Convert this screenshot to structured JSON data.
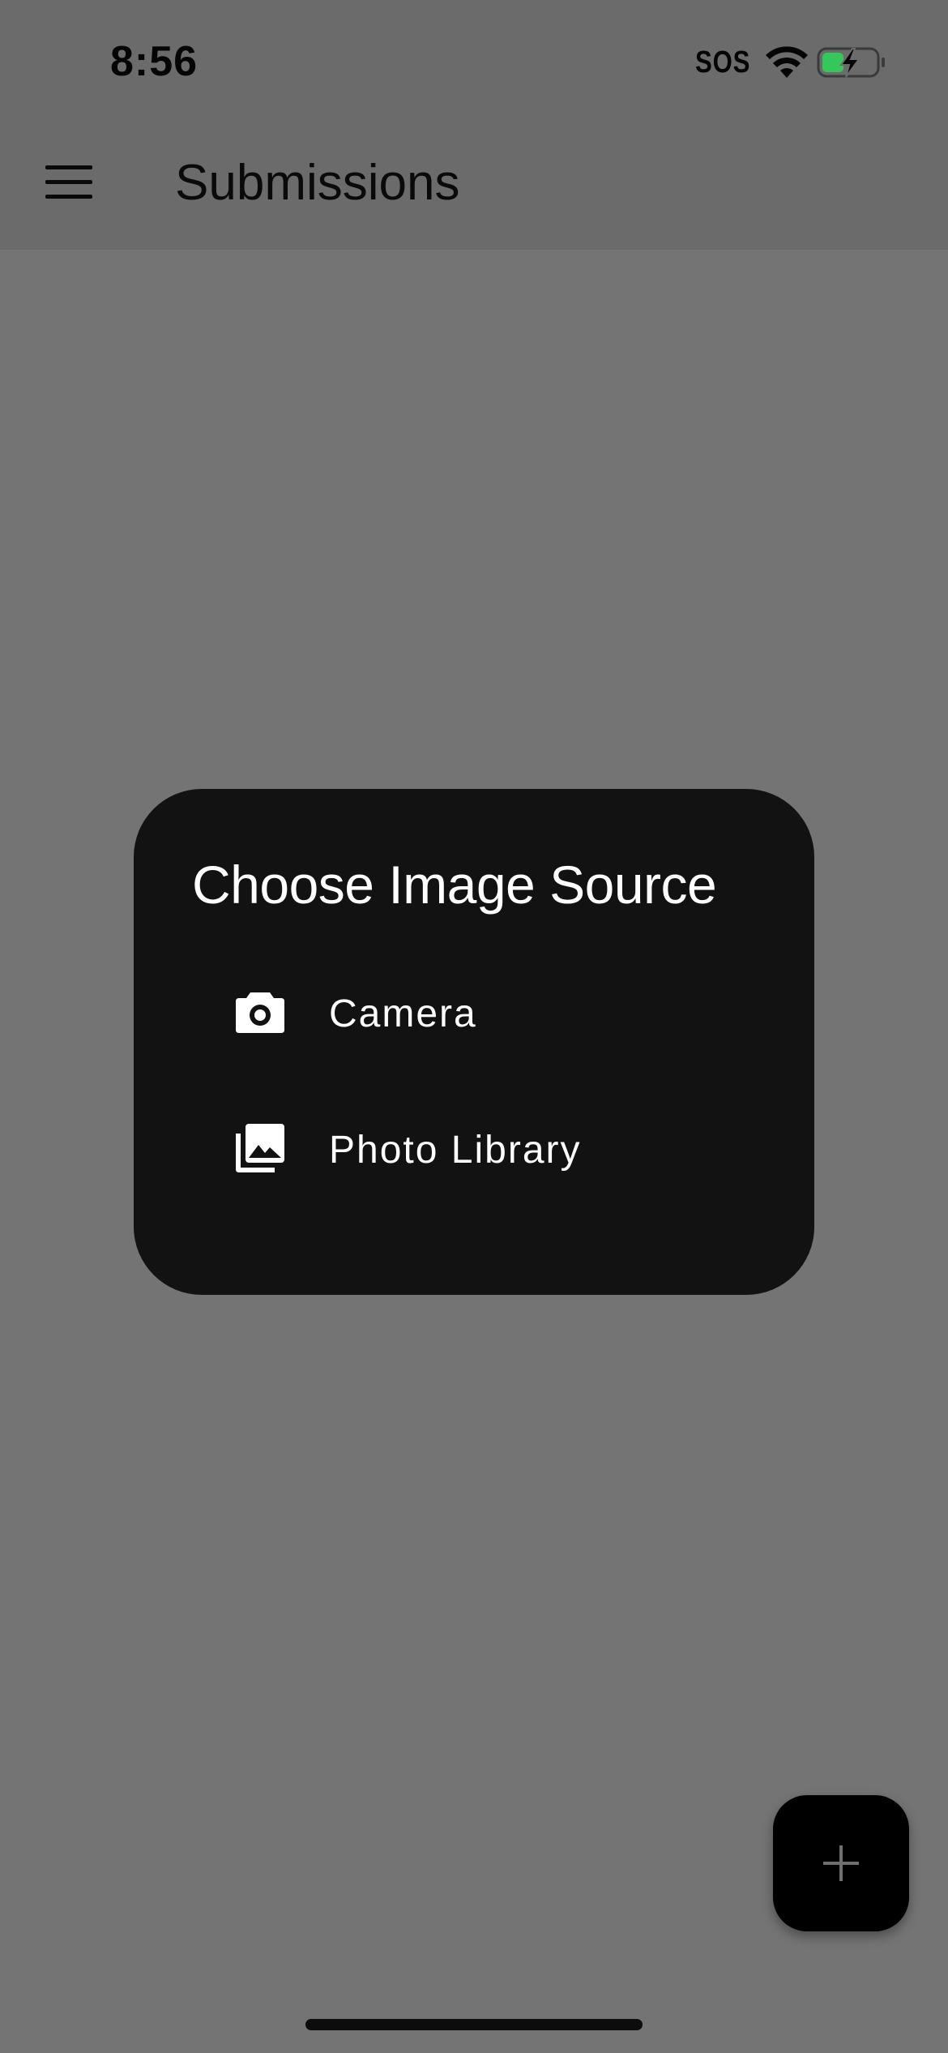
{
  "status_bar": {
    "time": "8:56",
    "carrier": "SOS",
    "wifi_icon": "wifi-icon",
    "battery_icon": "battery-charging-icon",
    "battery_color": "#34c759"
  },
  "app_bar": {
    "menu_icon": "hamburger-menu-icon",
    "title": "Submissions"
  },
  "dialog": {
    "title": "Choose Image Source",
    "options": [
      {
        "icon": "camera-icon",
        "label": "Camera"
      },
      {
        "icon": "photo-library-icon",
        "label": "Photo Library"
      }
    ],
    "background": "#121212"
  },
  "fab": {
    "icon": "plus-icon",
    "background": "#000000"
  }
}
